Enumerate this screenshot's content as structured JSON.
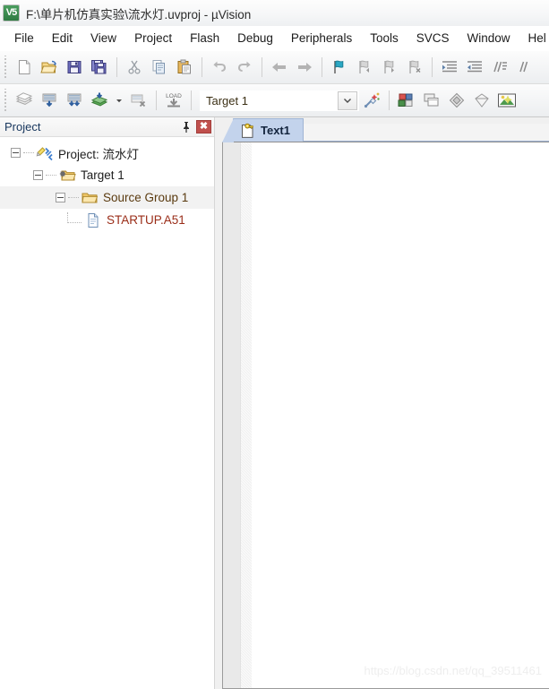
{
  "window": {
    "title": "F:\\单片机仿真实验\\流水灯.uvproj - µVision",
    "app_icon": "keil-uvision-icon",
    "icon_glyph": "V5"
  },
  "menubar": {
    "items": [
      {
        "label": "File",
        "name": "menu-file"
      },
      {
        "label": "Edit",
        "name": "menu-edit"
      },
      {
        "label": "View",
        "name": "menu-view"
      },
      {
        "label": "Project",
        "name": "menu-project"
      },
      {
        "label": "Flash",
        "name": "menu-flash"
      },
      {
        "label": "Debug",
        "name": "menu-debug"
      },
      {
        "label": "Peripherals",
        "name": "menu-peripherals"
      },
      {
        "label": "Tools",
        "name": "menu-tools"
      },
      {
        "label": "SVCS",
        "name": "menu-svcs"
      },
      {
        "label": "Window",
        "name": "menu-window"
      },
      {
        "label": "Hel",
        "name": "menu-help"
      }
    ]
  },
  "toolbar_file": {
    "buttons": [
      "new-file-icon",
      "open-file-icon",
      "save-icon",
      "save-all-icon",
      "cut-icon",
      "copy-icon",
      "paste-icon",
      "undo-icon",
      "redo-icon",
      "navigate-back-icon",
      "navigate-forward-icon",
      "bookmark-toggle-icon",
      "bookmark-prev-icon",
      "bookmark-next-icon",
      "bookmark-clear-icon",
      "indent-icon",
      "outdent-icon",
      "comment-icon",
      "uncomment-icon"
    ]
  },
  "toolbar_build": {
    "buttons": [
      "translate-icon",
      "build-icon",
      "rebuild-icon",
      "batch-build-icon",
      "batch-build-dropdown-icon",
      "stop-build-icon",
      "download-icon"
    ],
    "download_label": "LOAD",
    "target_select": {
      "value": "Target 1",
      "name": "target-select"
    },
    "right_buttons": [
      "target-options-icon",
      "manage-project-items-icon",
      "multi-project-window-icon",
      "components-icon",
      "books-icon",
      "configuration-wizard-icon"
    ]
  },
  "project_panel": {
    "title": "Project",
    "pin_icon": "pin-icon",
    "close_icon": "close-icon",
    "close_glyph": "✖",
    "tree": [
      {
        "label": "Project: 流水灯",
        "name": "tree-item-project",
        "icon": "project-icon",
        "depth": 0,
        "expanded": true,
        "selected": false
      },
      {
        "label": "Target 1",
        "name": "tree-item-target",
        "icon": "target-folder-icon",
        "depth": 1,
        "expanded": true,
        "selected": false
      },
      {
        "label": "Source Group 1",
        "name": "tree-item-source-group",
        "icon": "folder-icon",
        "depth": 2,
        "expanded": true,
        "selected": true
      },
      {
        "label": "STARTUP.A51",
        "name": "tree-item-startup-a51",
        "icon": "source-file-icon",
        "depth": 3,
        "expanded": false,
        "selected": false
      }
    ]
  },
  "editor": {
    "tabs": [
      {
        "label": "Text1",
        "name": "editor-tab-text1",
        "icon": "text-document-key-icon",
        "active": true
      }
    ],
    "content": ""
  },
  "watermark": {
    "text": "https://blog.csdn.net/qq_39511461"
  },
  "colors": {
    "accent_tab": "#c3d3ec",
    "close_button": "#c0504d",
    "title_text": "#2b2b2b",
    "panel_title": "#17365d",
    "tree_selected": "#f2f2f2"
  }
}
